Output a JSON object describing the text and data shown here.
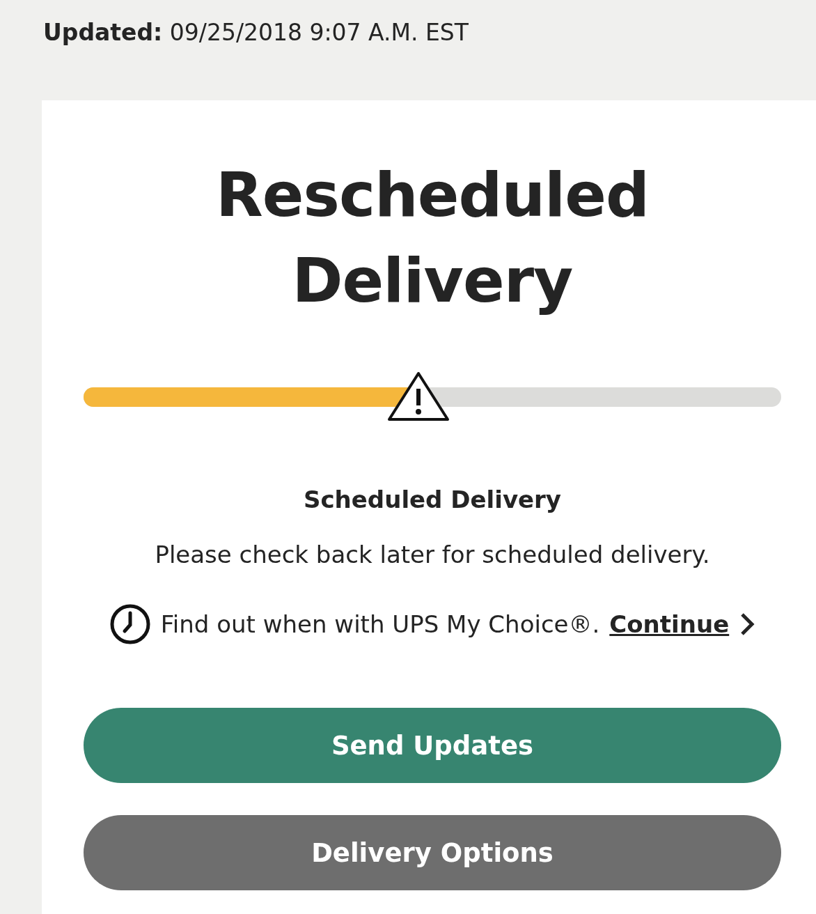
{
  "updated": "**Updated:** 09/25/2018 9:07 A.M. EST",
  "status_title": "Rescheduled Delivery",
  "progress": {
    "level": 0.48,
    "warning": true
  },
  "scheduled": {
    "heading": "Scheduled Delivery",
    "message": "Please check back later for scheduled delivery."
  },
  "my_choice": {
    "text": "Find out when with UPS My Choice®.",
    "link": "Continue"
  },
  "buttons": [
    {
      "label": "Send Updates",
      "kind": "primary"
    },
    {
      "label": "Delivery Options",
      "kind": "secondary"
    }
  ]
}
